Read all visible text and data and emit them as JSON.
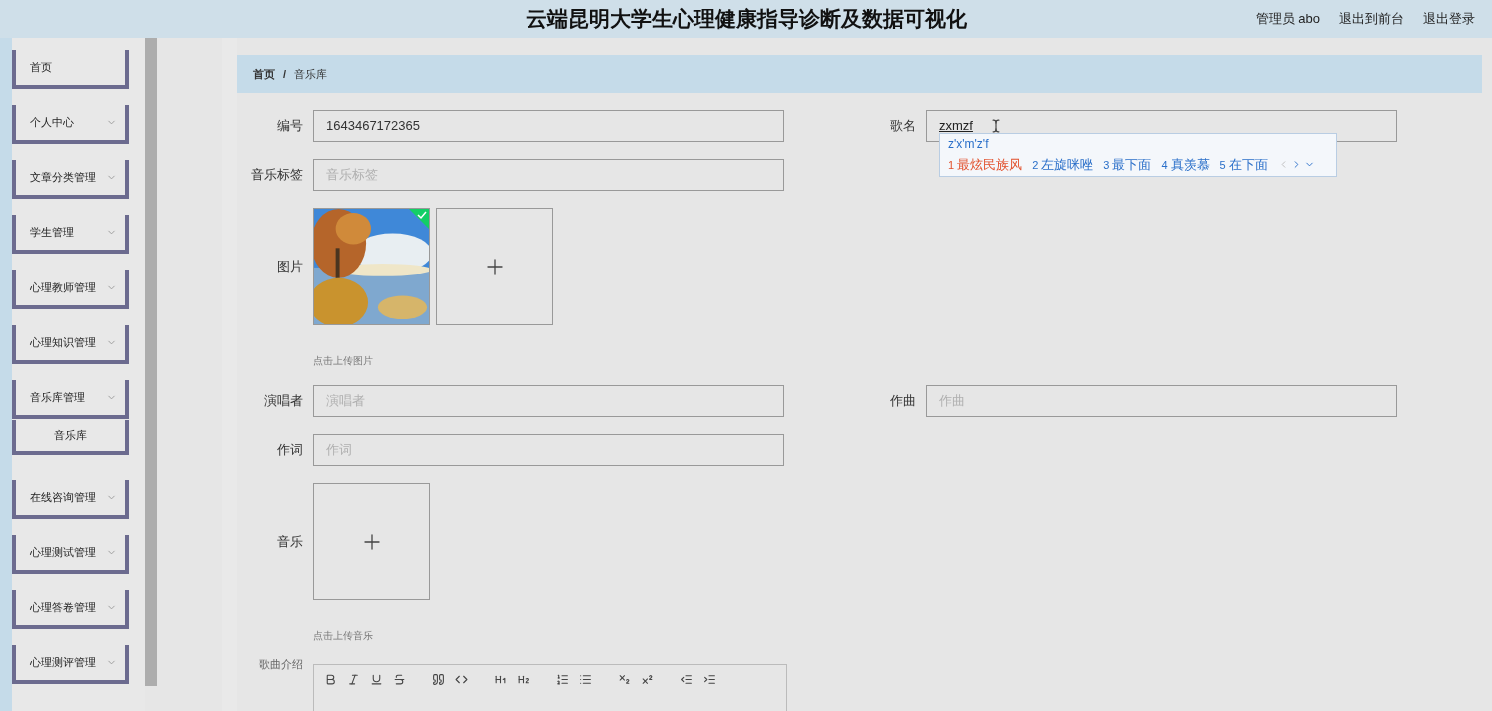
{
  "header": {
    "title": "云端昆明大学生心理健康指导诊断及数据可视化",
    "links": [
      "管理员 abo",
      "退出到前台",
      "退出登录"
    ]
  },
  "sidebar": {
    "items": [
      {
        "label": "首页",
        "kind": "link"
      },
      {
        "label": "个人中心",
        "kind": "menu"
      },
      {
        "label": "文章分类管理",
        "kind": "menu"
      },
      {
        "label": "学生管理",
        "kind": "menu"
      },
      {
        "label": "心理教师管理",
        "kind": "menu"
      },
      {
        "label": "心理知识管理",
        "kind": "menu"
      },
      {
        "label": "音乐库管理",
        "kind": "menu"
      },
      {
        "label": "音乐库",
        "kind": "sub"
      },
      {
        "label": "在线咨询管理",
        "kind": "menu"
      },
      {
        "label": "心理测试管理",
        "kind": "menu"
      },
      {
        "label": "心理答卷管理",
        "kind": "menu"
      },
      {
        "label": "心理测评管理",
        "kind": "menu"
      }
    ]
  },
  "breadcrumb": {
    "items": [
      "首页",
      "音乐库"
    ],
    "separator": "/"
  },
  "form": {
    "rows": [
      {
        "fields": [
          {
            "label": "编号",
            "kind": "text",
            "value": "1643467172365"
          },
          {
            "label": "歌名",
            "kind": "text",
            "value": "zxmzf",
            "ime": {
              "composition": "z'x'm'z'f",
              "candidates": [
                {
                  "index": "1",
                  "text": "最炫民族风",
                  "selected": true
                },
                {
                  "index": "2",
                  "text": "左旋咪唑",
                  "selected": false
                },
                {
                  "index": "3",
                  "text": "最下面",
                  "selected": false
                },
                {
                  "index": "4",
                  "text": "真羡慕",
                  "selected": false
                },
                {
                  "index": "5",
                  "text": "在下面",
                  "selected": false
                }
              ]
            }
          }
        ]
      },
      {
        "fields": [
          {
            "label": "音乐标签",
            "kind": "text",
            "placeholder": "音乐标签"
          }
        ]
      },
      {
        "fields": [
          {
            "label": "图片",
            "kind": "upload",
            "files": [
              {
                "kind": "picture",
                "uploaded": true
              }
            ],
            "hint": "点击上传图片"
          }
        ]
      },
      {
        "fields": [
          {
            "label": "演唱者",
            "kind": "text",
            "placeholder": "演唱者"
          },
          {
            "label": "作曲",
            "kind": "text",
            "placeholder": "作曲"
          }
        ]
      },
      {
        "fields": [
          {
            "label": "作词",
            "kind": "text",
            "placeholder": "作词"
          }
        ]
      },
      {
        "fields": [
          {
            "label": "音乐",
            "kind": "upload",
            "hint": "点击上传音乐"
          }
        ]
      },
      {
        "fields": [
          {
            "label": "歌曲介绍",
            "kind": "editor"
          }
        ]
      }
    ]
  }
}
